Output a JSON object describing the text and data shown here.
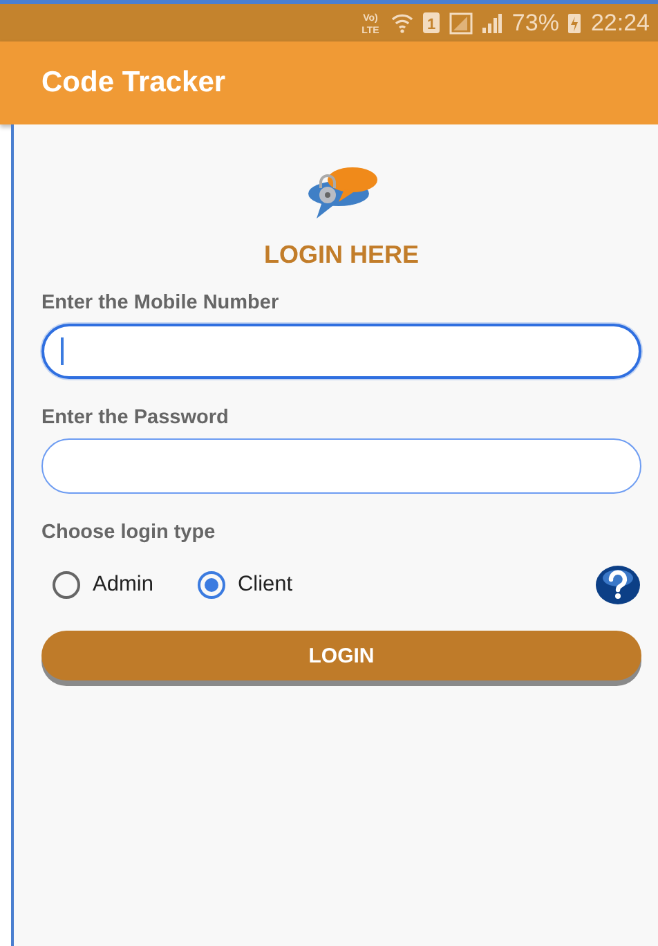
{
  "status_bar": {
    "volte": [
      "Vo)",
      "LTE"
    ],
    "sim": "1",
    "battery": "73%",
    "time": "22:24"
  },
  "app_bar": {
    "title": "Code Tracker"
  },
  "heading": "LOGIN HERE",
  "fields": [
    {
      "label": "Enter the Mobile Number",
      "focused": true
    },
    {
      "label": "Enter the Password",
      "focused": false
    }
  ],
  "login_type": {
    "label": "Choose login type",
    "options": [
      {
        "label": "Admin",
        "selected": false
      },
      {
        "label": "Client",
        "selected": true
      }
    ]
  },
  "login_button": "LOGIN"
}
